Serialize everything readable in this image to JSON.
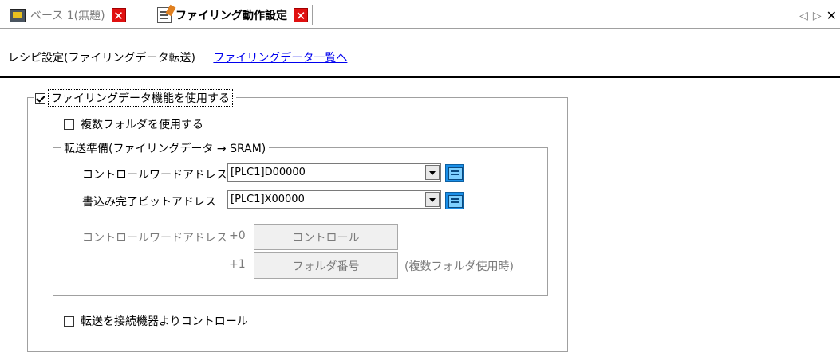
{
  "tabs": [
    {
      "label": "ベース 1(無題)",
      "active": false,
      "icon": "monitor-icon"
    },
    {
      "label": "ファイリング動作設定",
      "active": true,
      "icon": "document-icon"
    }
  ],
  "nav": {
    "prev": "◁",
    "next": "▷",
    "close": "✕"
  },
  "breadcrumb": {
    "current": "レシピ設定(ファイリングデータ転送)",
    "link": "ファイリングデータ一覧へ"
  },
  "filing_group": {
    "checkbox_label": "ファイリングデータ機能を使用する",
    "checked": true
  },
  "multi_folder": {
    "label": "複数フォルダを使用する",
    "checked": false
  },
  "transfer_group": {
    "title": "転送準備(ファイリングデータ → SRAM)",
    "control_word_label": "コントロールワードアドレス",
    "control_word_value": "[PLC1]D00000",
    "write_done_label": "書込み完了ビットアドレス",
    "write_done_value": "[PLC1]X00000",
    "info_label": "コントロールワードアドレス",
    "offset0": "+0",
    "offset0_box": "コントロール",
    "offset1": "+1",
    "offset1_box": "フォルダ番号",
    "offset1_note": "(複数フォルダ使用時)"
  },
  "device_control": {
    "label": "転送を接続機器よりコントロール",
    "checked": false
  },
  "colors": {
    "close_red": "#e01010",
    "link_blue": "#0000ee",
    "address_button_blue": "#1a8fe8"
  }
}
